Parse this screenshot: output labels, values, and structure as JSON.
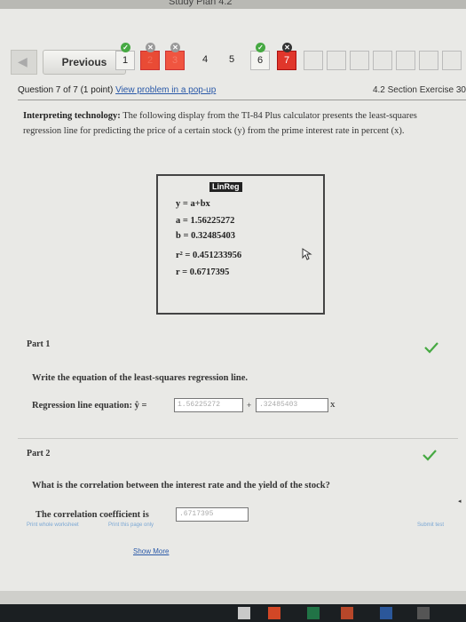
{
  "bezel": {
    "text": "Study Plan 4.2"
  },
  "navigation": {
    "previous_label": "Previous",
    "questions": [
      {
        "label": "1",
        "status": "correct"
      },
      {
        "label": "2",
        "status": "incorrect"
      },
      {
        "label": "3",
        "status": "incorrect"
      },
      {
        "label": "4",
        "status": "unanswered"
      },
      {
        "label": "5",
        "status": "unanswered"
      },
      {
        "label": "6",
        "status": "correct"
      },
      {
        "label": "7",
        "status": "current"
      }
    ]
  },
  "question": {
    "number_text": "Question 7 of 7 (1 point)",
    "popup_link": "View problem in a pop-up",
    "section": "4.2 Section Exercise 30"
  },
  "prompt": {
    "lead": "Interpreting technology:",
    "text": " The following display from the TI-84 Plus calculator presents the least-squares regression line for predicting the price of a certain stock (y) from the prime interest rate in percent (x)."
  },
  "calculator": {
    "title": "LinReg",
    "lines": [
      "y = a+bx",
      "a = 1.56225272",
      "b = 0.32485403",
      "r² = 0.451233956",
      "r = 0.6717395"
    ]
  },
  "part1": {
    "label": "Part 1",
    "instruction": "Write the equation of the least-squares regression line.",
    "equation_label": "Regression line equation: ŷ =",
    "intercept_value": "1.56225272",
    "plus": "+",
    "slope_value": ".32485403",
    "x_var": "x"
  },
  "part2": {
    "label": "Part 2",
    "question": "What is the correlation between the interest rate and the yield of the stock?",
    "answer_label": "The correlation coefficient is",
    "answer_value": ".6717395"
  },
  "footer": {
    "link_left": "Print whole worksheet",
    "link_mid": "Print this page only",
    "link_right": "Submit test",
    "show_more": "Show More"
  },
  "colors": {
    "correct": "#46a942",
    "incorrect": "#e94b35",
    "link": "#2a59a8"
  }
}
